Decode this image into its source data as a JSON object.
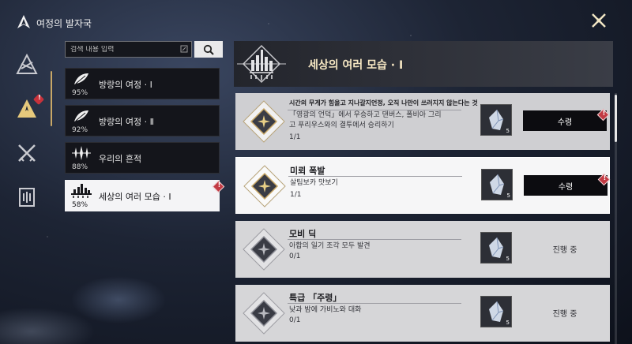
{
  "app": {
    "title": "여정의 발자국"
  },
  "search": {
    "placeholder": "검색 내용 입력"
  },
  "journeys": [
    {
      "label": "방랑의 여정 · Ⅰ",
      "percent": "95%",
      "icon": "feather-icon"
    },
    {
      "label": "방랑의 여정 · Ⅱ",
      "percent": "92%",
      "icon": "feather-icon"
    },
    {
      "label": "우리의 흔적",
      "percent": "88%",
      "icon": "sparkle-icon"
    },
    {
      "label": "세상의 여러 모습 · Ⅰ",
      "percent": "58%",
      "icon": "city-icon",
      "active": true,
      "alert": "!"
    }
  ],
  "content": {
    "title": "세상의 여러 모습 · Ⅰ"
  },
  "quests": [
    {
      "title": "시간의 무게가 힘을고 지나갈지언정, 오직 나만이 쓰러지지 않는다는 것",
      "desc": "「영광의 언덕」에서 우승하고 댄버스, 폴비아 그리고 푸리우스와의 결투에서 승리하기",
      "count": "1/1",
      "reward_qty": "5",
      "action": "수령",
      "alert": "!"
    },
    {
      "title": "미뢰 폭발",
      "desc": "살팀보카 맛보기",
      "count": "1/1",
      "reward_qty": "5",
      "action": "수령",
      "alert": "!"
    },
    {
      "title": "모비 딕",
      "desc": "아합의 일기 조각 모두 발견",
      "count": "0/1",
      "reward_qty": "5",
      "status": "진행 중"
    },
    {
      "title": "특급 「주령」",
      "desc": "낮과 밤에 가비노와 대화",
      "count": "0/1",
      "reward_qty": "5",
      "status": "진행 중"
    }
  ],
  "colors": {
    "accent": "#c9a867",
    "alert": "#c23a43",
    "card": "#d6d6d8",
    "card_selected": "#f6f6f7"
  }
}
